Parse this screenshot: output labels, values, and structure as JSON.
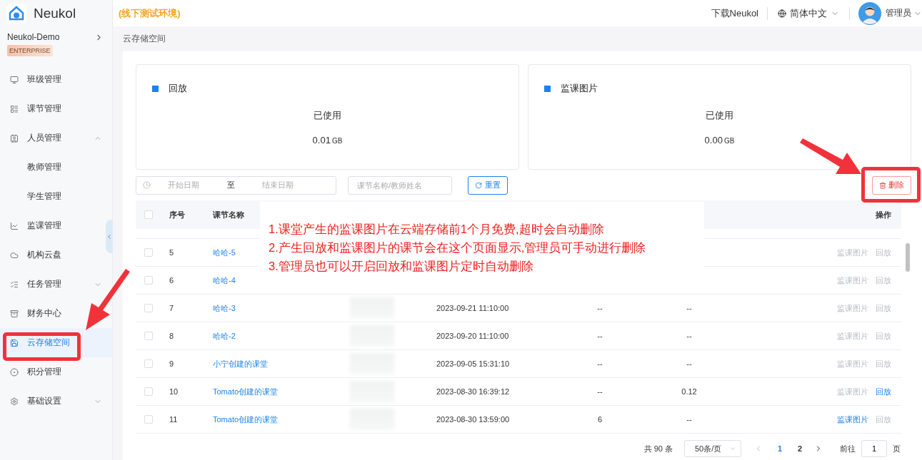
{
  "brand": {
    "name": "Neukol"
  },
  "env_label": "(线下测试环境)",
  "header": {
    "download": "下载Neukol",
    "language": "简体中文",
    "user": "管理员"
  },
  "org": {
    "name": "Neukol-Demo",
    "badge": "ENTERPRISE"
  },
  "sidebar": {
    "items": [
      {
        "label": "班级管理",
        "selected": false
      },
      {
        "label": "课节管理",
        "selected": false
      },
      {
        "label": "人员管理",
        "selected": false,
        "expanded": true,
        "children": [
          {
            "label": "教师管理",
            "selected": false
          },
          {
            "label": "学生管理",
            "selected": false
          }
        ]
      },
      {
        "label": "监课管理",
        "selected": false
      },
      {
        "label": "机构云盘",
        "selected": false
      },
      {
        "label": "任务管理",
        "selected": false,
        "expanded": false
      },
      {
        "label": "财务中心",
        "selected": false
      },
      {
        "label": "云存储空间",
        "selected": true
      },
      {
        "label": "积分管理",
        "selected": false
      },
      {
        "label": "基础设置",
        "selected": false,
        "expanded": false
      }
    ]
  },
  "breadcrumb": "云存储空间",
  "cards": [
    {
      "title": "回放",
      "caption": "已使用",
      "value": "0.01",
      "unit": "GB"
    },
    {
      "title": "监课图片",
      "caption": "已使用",
      "value": "0.00",
      "unit": "GB"
    }
  ],
  "filters": {
    "start_placeholder": "开始日期",
    "separator": "至",
    "end_placeholder": "结束日期",
    "search_placeholder": "课节名称/教师姓名",
    "reset": "重置"
  },
  "delete_button": "删除",
  "table": {
    "columns": [
      "序号",
      "课节名称",
      "操作"
    ],
    "all_checked": false,
    "rows": [
      {
        "seq": "5",
        "checked": false,
        "name": "哈哈-5",
        "actions": [
          {
            "label": "监课图片",
            "enabled": false
          },
          {
            "label": "回放",
            "enabled": false
          }
        ]
      },
      {
        "seq": "6",
        "checked": false,
        "name": "哈哈-4",
        "actions": [
          {
            "label": "监课图片",
            "enabled": false
          },
          {
            "label": "回放",
            "enabled": false
          }
        ]
      },
      {
        "seq": "7",
        "checked": false,
        "name": "哈哈-3",
        "redacted": true,
        "time": "2023-09-21 11:10:00",
        "column_5": "--",
        "column_6": "--",
        "actions": [
          {
            "label": "监课图片",
            "enabled": false
          },
          {
            "label": "回放",
            "enabled": false
          }
        ]
      },
      {
        "seq": "8",
        "checked": false,
        "name": "哈哈-2",
        "redacted": true,
        "time": "2023-09-20 11:10:00",
        "column_5": "--",
        "column_6": "--",
        "actions": [
          {
            "label": "监课图片",
            "enabled": false
          },
          {
            "label": "回放",
            "enabled": false
          }
        ]
      },
      {
        "seq": "9",
        "checked": false,
        "name": "小宁创建的课堂",
        "redacted": true,
        "time": "2023-09-05 15:31:10",
        "column_5": "--",
        "column_6": "--",
        "actions": [
          {
            "label": "监课图片",
            "enabled": false
          },
          {
            "label": "回放",
            "enabled": false
          }
        ]
      },
      {
        "seq": "10",
        "checked": false,
        "name": "Tomato创建的课堂",
        "redacted": true,
        "time": "2023-08-30 16:39:12",
        "column_5": "--",
        "column_6": "0.12",
        "actions": [
          {
            "label": "监课图片",
            "enabled": false
          },
          {
            "label": "回放",
            "enabled": true
          }
        ]
      },
      {
        "seq": "11",
        "checked": false,
        "name": "Tomato创建的课堂",
        "redacted": true,
        "time": "2023-08-30 13:59:00",
        "column_5": "6",
        "column_6": "--",
        "actions": [
          {
            "label": "监课图片",
            "enabled": true
          },
          {
            "label": "回放",
            "enabled": false
          }
        ]
      }
    ]
  },
  "pagination": {
    "total": "共 90 条",
    "page_size": "50条/页",
    "pages": [
      {
        "label": "1",
        "selected": true
      },
      {
        "label": "2",
        "selected": false
      }
    ],
    "goto_label": "前往",
    "goto_value": "1",
    "goto_suffix": "页"
  },
  "callout": {
    "lines": [
      "1.课堂产生的监课图片在云端存储前1个月免费,超时会自动删除",
      "2.产生回放和监课图片的课节会在这个页面显示,管理员可手动进行删除",
      "3.管理员也可以开启回放和监课图片定时自动删除"
    ]
  }
}
